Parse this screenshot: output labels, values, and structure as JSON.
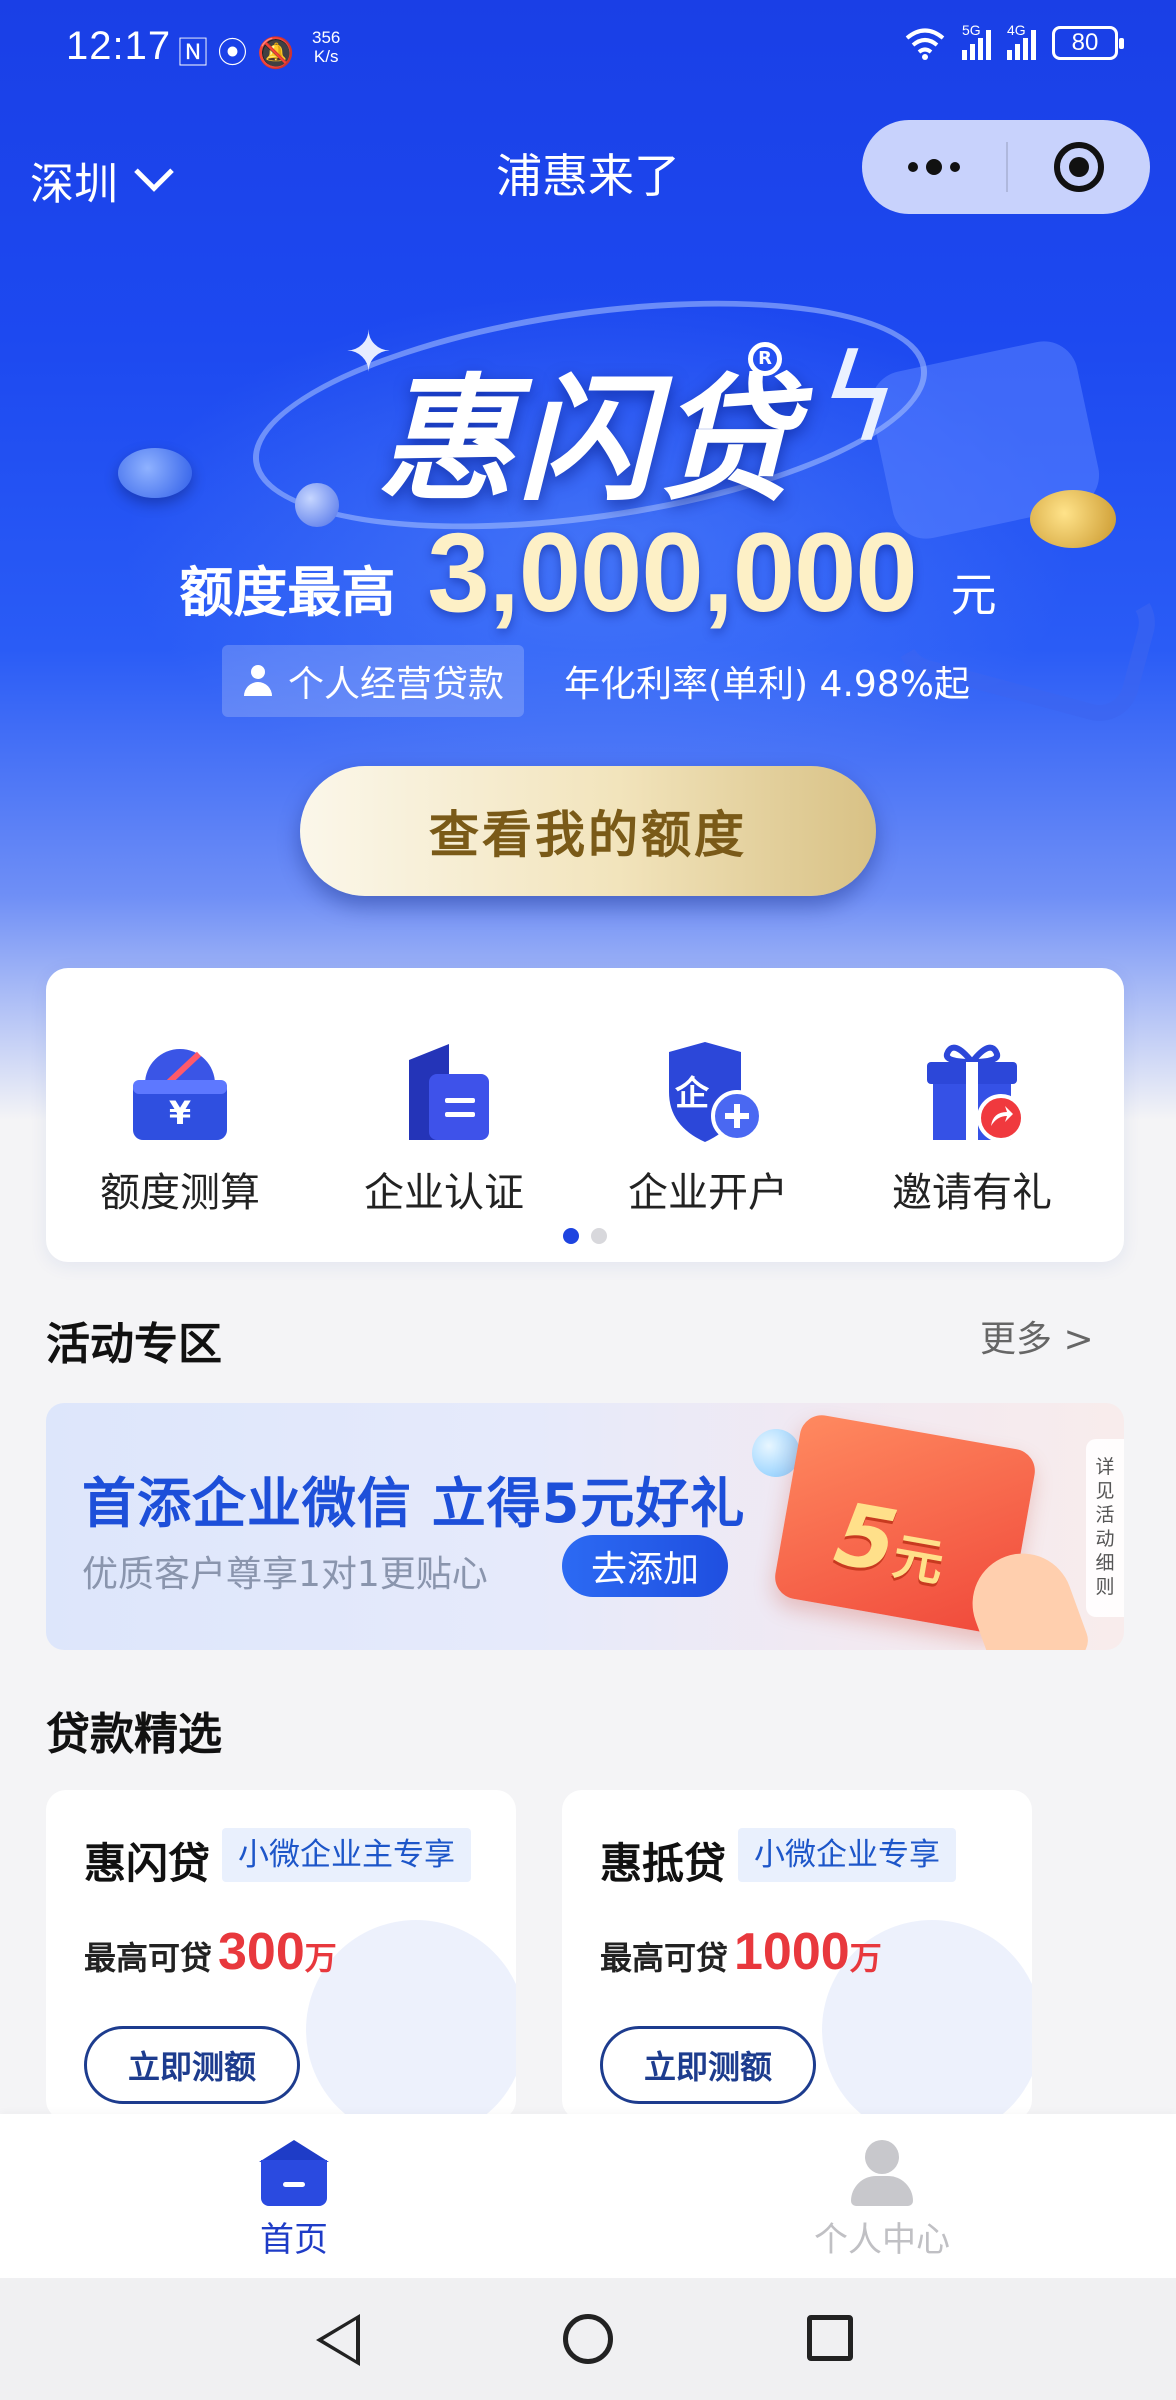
{
  "status_bar": {
    "time": "12:17",
    "left_icons": "🄽 ⦿ 🔕",
    "net_speed_value": "356",
    "net_speed_unit": "K/s",
    "sig1_label": "5G",
    "sig2_label": "4G",
    "battery": "80"
  },
  "nav": {
    "city": "深圳",
    "title": "浦惠来了",
    "capsule_more_icon": "more-dots-icon",
    "capsule_close_icon": "target-ring-icon"
  },
  "hero": {
    "brand": "惠闪贷",
    "brand_mark": "R",
    "limit_label": "额度最高",
    "limit_value": "3,000,000",
    "limit_unit": "元",
    "tag": "个人经营贷款",
    "rate": "年化利率(单利) 4.98%起",
    "cta": "查看我的额度"
  },
  "quick_actions": [
    {
      "label": "额度测算",
      "icon": "wallet-gauge-icon",
      "symbol": "¥"
    },
    {
      "label": "企业认证",
      "icon": "building-doc-icon"
    },
    {
      "label": "企业开户",
      "icon": "shield-plus-icon",
      "symbol": "企"
    },
    {
      "label": "邀请有礼",
      "icon": "gift-share-icon"
    }
  ],
  "pager": {
    "total": 2,
    "active": 0
  },
  "activity": {
    "title": "活动专区",
    "more": "更多 >",
    "banner": {
      "title": "首添企业微信 立得5元好礼",
      "subtitle": "优质客户尊享1对1更贴心",
      "button": "去添加",
      "card_value": "5",
      "card_unit": "元",
      "side_label": "详见活动细则"
    }
  },
  "loans": {
    "title": "贷款精选",
    "items": [
      {
        "name": "惠闪贷",
        "tag": "小微企业主专享",
        "amount_label": "最高可贷",
        "amount": "300",
        "unit": "万",
        "button": "立即测额"
      },
      {
        "name": "惠抵贷",
        "tag": "小微企业专享",
        "amount_label": "最高可贷",
        "amount": "1000",
        "unit": "万",
        "button": "立即测额"
      }
    ]
  },
  "tabbar": {
    "home": "首页",
    "profile": "个人中心",
    "active_color": "#1e3cc7",
    "inactive_color": "#c0c0c4"
  },
  "colors": {
    "brand_blue": "#1d49f0",
    "price_red": "#e8383d",
    "gold": "#f2e4bc"
  }
}
